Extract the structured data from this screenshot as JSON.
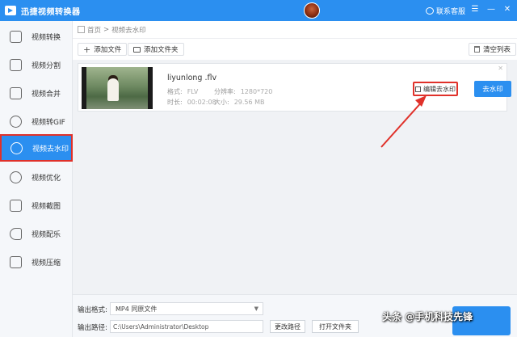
{
  "app": {
    "title": "迅捷视频转换器",
    "support": "联系客服"
  },
  "window_controls": [
    "☰",
    "—",
    "✕"
  ],
  "sidebar": {
    "items": [
      {
        "label": "视频转换",
        "icon": "convert-icon"
      },
      {
        "label": "视频分割",
        "icon": "split-icon"
      },
      {
        "label": "视频合并",
        "icon": "merge-icon"
      },
      {
        "label": "视频转GIF",
        "icon": "gif-icon"
      },
      {
        "label": "视频去水印",
        "icon": "watermark-icon",
        "active": true
      },
      {
        "label": "视频优化",
        "icon": "optimize-icon"
      },
      {
        "label": "视频截图",
        "icon": "screenshot-icon"
      },
      {
        "label": "视频配乐",
        "icon": "music-icon"
      },
      {
        "label": "视频压缩",
        "icon": "compress-icon"
      }
    ]
  },
  "breadcrumb": {
    "home": "首页",
    "separator": ">",
    "current": "视频去水印"
  },
  "toolbar": {
    "add_file": "添加文件",
    "add_folder": "添加文件夹",
    "clear_list": "清空列表"
  },
  "file": {
    "name": "liyunlong .flv",
    "format_label": "格式:",
    "format": "FLV",
    "resolution_label": "分辨率:",
    "resolution": "1280*720",
    "duration_label": "时长:",
    "duration": "00:02:08",
    "size_label": "大小:",
    "size": "29.56 MB",
    "edit_label": "编辑去水印",
    "remove_label": "去水印",
    "close": "✕"
  },
  "footer": {
    "format_label": "输出格式:",
    "format_value": "MP4  同原文件",
    "path_label": "输出路径:",
    "path_value": "C:\\Users\\Administrator\\Desktop",
    "change_path": "更改路径",
    "open_folder": "打开文件夹"
  },
  "watermark": "头条 @手机科技先锋",
  "colors": {
    "accent": "#2b8ff0",
    "highlight": "#e0312a"
  }
}
